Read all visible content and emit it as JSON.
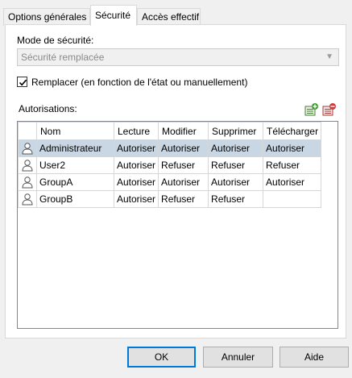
{
  "tabs": [
    {
      "label": "Options générales"
    },
    {
      "label": "Sécurité"
    },
    {
      "label": "Accès effectif"
    }
  ],
  "security_mode": {
    "label": "Mode de sécurité:",
    "selected_value": "Sécurité remplacée"
  },
  "override": {
    "checked": true,
    "label": "Remplacer (en fonction de l'état ou manuellement)"
  },
  "permissions": {
    "label": "Autorisations:",
    "add_icon": "add-permission-icon",
    "remove_icon": "remove-permission-icon",
    "columns": [
      "Nom",
      "Lecture",
      "Modifier",
      "Supprimer",
      "Télécharger"
    ],
    "rows": [
      {
        "name": "Administrateur",
        "read": "Autoriser",
        "modify": "Autoriser",
        "delete": "Autoriser",
        "download": "Autoriser",
        "selected": true
      },
      {
        "name": "User2",
        "read": "Autoriser",
        "modify": "Refuser",
        "delete": "Refuser",
        "download": "Refuser",
        "selected": false
      },
      {
        "name": "GroupA",
        "read": "Autoriser",
        "modify": "Autoriser",
        "delete": "Autoriser",
        "download": "Autoriser",
        "selected": false
      },
      {
        "name": "GroupB",
        "read": "Autoriser",
        "modify": "Refuser",
        "delete": "Refuser",
        "download": "",
        "selected": false
      }
    ]
  },
  "buttons": {
    "ok": "OK",
    "cancel": "Annuler",
    "help": "Aide"
  },
  "colors": {
    "selection": "#c9d7e4",
    "default_button_border": "#0078d7"
  }
}
